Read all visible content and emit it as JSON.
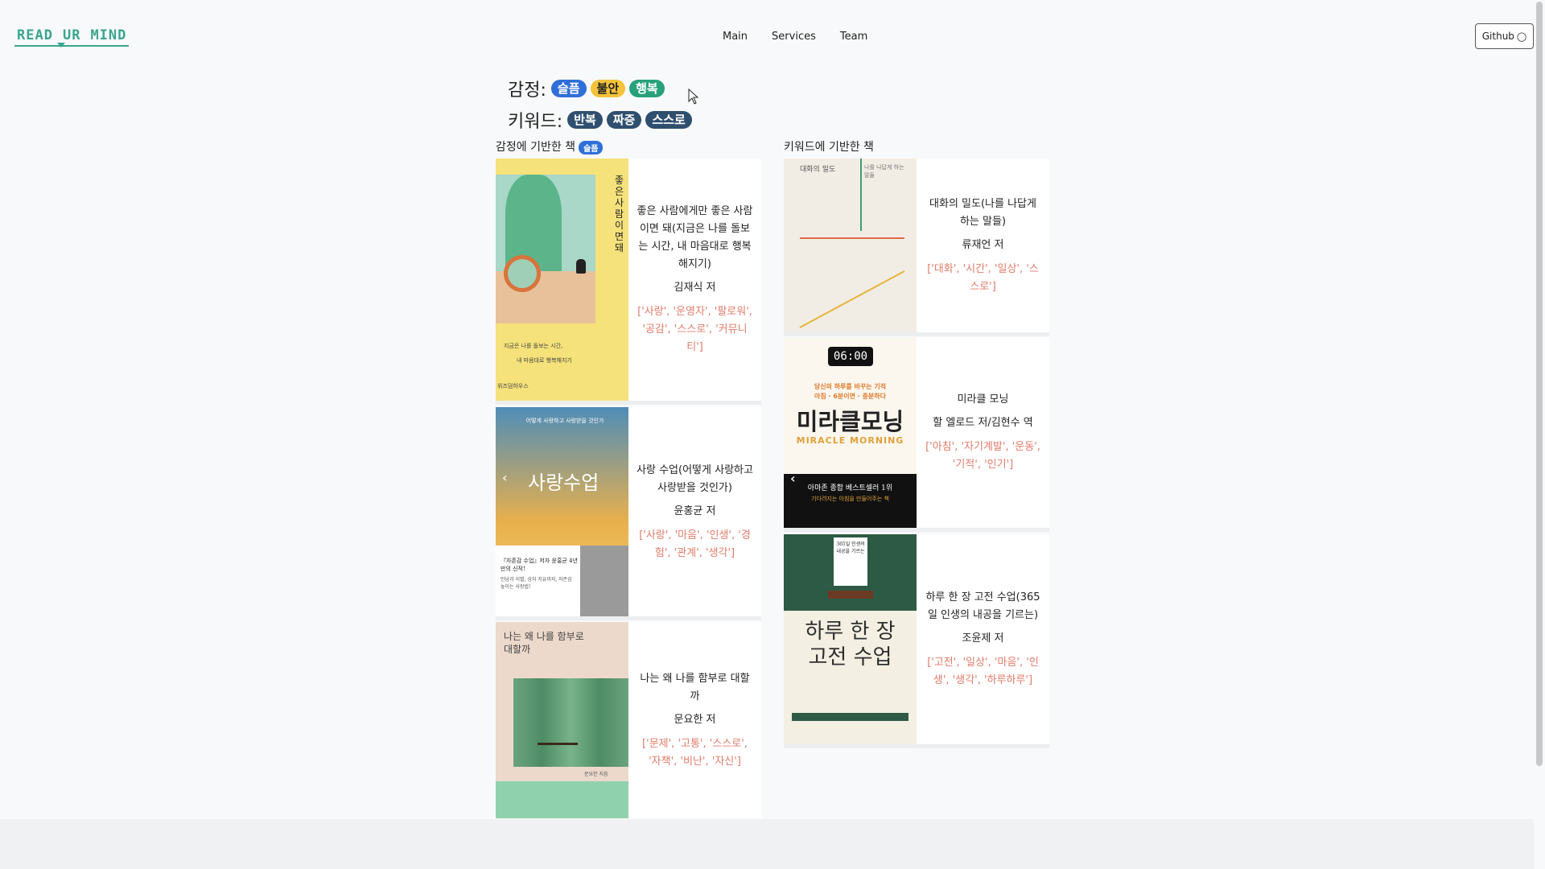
{
  "logo": {
    "words": [
      "READ",
      "UR",
      "MIND"
    ]
  },
  "nav": {
    "main": "Main",
    "services": "Services",
    "team": "Team"
  },
  "github": {
    "label": "Github"
  },
  "emotion": {
    "label": "감정:",
    "tags": [
      "슬픔",
      "불안",
      "행복"
    ]
  },
  "keyword": {
    "label": "키워드:",
    "tags": [
      "반복",
      "짜증",
      "스스로"
    ]
  },
  "left_column": {
    "title": "감정에 기반한 책",
    "badge": "슬픔",
    "books": [
      {
        "title": "좋은 사람에게만 좋은 사람이면 돼(지금은 나를 돌보는 시간, 내 마음대로 행복해지기)",
        "author": "김재식 저",
        "keywords": "['사랑', '운영자', '팔로워', '공감', '스스로', '커뮤니티']",
        "cover_title": "좋은 사람이면 돼",
        "cover_sub": "지금은 나를 돌보는 시간,",
        "cover_sub2": "내 마음대로 행복해지기",
        "cover_pub": "위즈덤하우스"
      },
      {
        "title": "사랑 수업(어떻게 사랑하고 사랑받을 것인가)",
        "author": "윤홍균 저",
        "keywords": "['사랑', '마음', '인생', '경험', '관계', '생각']",
        "cover_title": "사랑수업",
        "cover_top": "어떻게 사랑하고 사랑받을 것인가",
        "cover_quote": "『자존감 수업』저자 윤홍균 4년 만의 신작!",
        "cover_quote2": "만남과 이별, 상처 치유까지, 자존감 높이는 사랑법!"
      },
      {
        "title": "나는 왜 나를 함부로 대할까",
        "author": "문요한 저",
        "keywords": "['문제', '고통', '스스로', '자책', '비난', '자신']",
        "cover_title": "나는 왜 나를 함부로 대할까",
        "cover_author": "문요한 지음"
      }
    ]
  },
  "right_column": {
    "title": "키워드에 기반한 책",
    "books": [
      {
        "title": "대화의 밀도(나를 나답게 하는 말들)",
        "author": "류재언 저",
        "keywords": "['대화', '시간', '일상', '스스로']",
        "cover_title": "대화의 밀도",
        "cover_sub": "나를 나답게 하는 말들"
      },
      {
        "title": "미라클 모닝",
        "author": "할 엘로드 저/김현수 역",
        "keywords": "['아침', '자기계발', '운동', '기적', '인기']",
        "cover_clock": "06:00",
        "cover_tag": "당신의 하루를 바꾸는 기적",
        "cover_tag2": "아침 · 6분이면 · 충분하다",
        "cover_title": "미라클모닝",
        "cover_en": "MIRACLE MORNING",
        "cover_best": "아마존 종합 베스트셀러 1위",
        "cover_best2": "기다려지는 아침을 만들어주는 책"
      },
      {
        "title": "하루 한 장 고전 수업(365일 인생의 내공을 기르는)",
        "author": "조윤제 저",
        "keywords": "['고전', '일상', '마음', '인생', '생각', '하루하루']",
        "cover_top": "365일 인생의 내공을 기르는",
        "cover_title1": "하루 한 장",
        "cover_title2": "고전 수업"
      }
    ]
  },
  "colors": {
    "accent": "#3aa58f",
    "keyword_text": "#e07b6a",
    "badge_blue": "#2f6fd8",
    "badge_yellow": "#f3c33a",
    "badge_green": "#28a17a",
    "badge_dark": "#2f4f6f"
  }
}
